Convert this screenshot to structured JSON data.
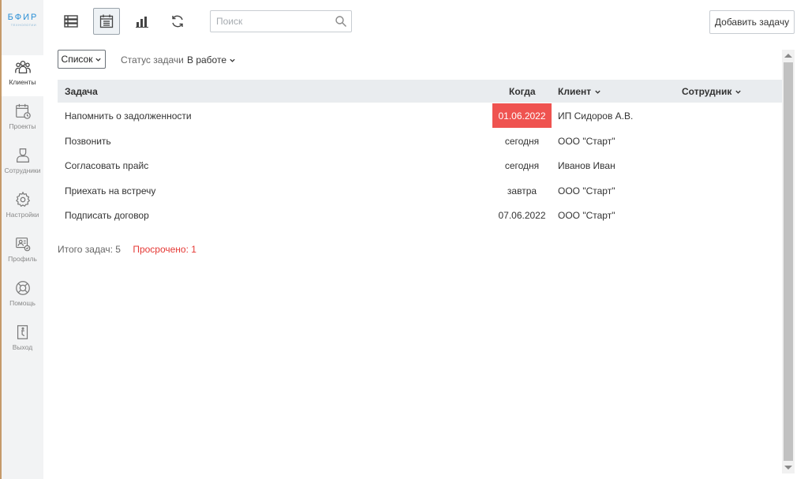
{
  "app": {
    "logo_text": "БФИР",
    "logo_subtext": "ТЕХНОЛОГИИ"
  },
  "sidebar": {
    "items": [
      {
        "label": "Клиенты",
        "icon": "clients-icon",
        "active": true
      },
      {
        "label": "Проекты",
        "icon": "projects-icon",
        "active": false
      },
      {
        "label": "Сотрудники",
        "icon": "employees-icon",
        "active": false
      },
      {
        "label": "Настройки",
        "icon": "settings-icon",
        "active": false
      },
      {
        "label": "Профиль",
        "icon": "profile-icon",
        "active": false
      },
      {
        "label": "Помощь",
        "icon": "help-icon",
        "active": false
      },
      {
        "label": "Выход",
        "icon": "exit-icon",
        "active": false
      }
    ]
  },
  "toolbar": {
    "buttons": [
      {
        "icon": "list-view-icon",
        "active": false
      },
      {
        "icon": "calendar-icon",
        "active": true
      },
      {
        "icon": "bar-chart-icon",
        "active": false
      },
      {
        "icon": "refresh-icon",
        "active": false
      }
    ],
    "search": {
      "placeholder": "Поиск",
      "value": ""
    },
    "add_task_label": "Добавить задачу"
  },
  "filters": {
    "view_selected": "Список",
    "status_label": "Статус задачи",
    "status_value": "В работе"
  },
  "table": {
    "columns": {
      "task": "Задача",
      "when": "Когда",
      "client": "Клиент",
      "employee": "Сотрудник"
    },
    "rows": [
      {
        "task": "Напомнить о задолженности",
        "when": "01.06.2022",
        "client": "ИП Сидоров А.В.",
        "employee": "",
        "overdue": true
      },
      {
        "task": "Позвонить",
        "when": "сегодня",
        "client": "ООО \"Старт\"",
        "employee": "",
        "overdue": false
      },
      {
        "task": "Согласовать прайс",
        "when": "сегодня",
        "client": "Иванов Иван",
        "employee": "",
        "overdue": false
      },
      {
        "task": "Приехать на встречу",
        "when": "завтра",
        "client": "ООО \"Старт\"",
        "employee": "",
        "overdue": false
      },
      {
        "task": "Подписать договор",
        "when": "07.06.2022",
        "client": "ООО \"Старт\"",
        "employee": "",
        "overdue": false
      }
    ]
  },
  "summary": {
    "total": "Итого задач: 5",
    "overdue": "Просрочено: 1"
  },
  "colors": {
    "overdue_bg": "#ef5350",
    "overdue_text": "#e53935",
    "header_bg": "#e9ecef",
    "sidebar_bg": "#f2f3f4",
    "logo_accent": "#2a8fd6"
  }
}
